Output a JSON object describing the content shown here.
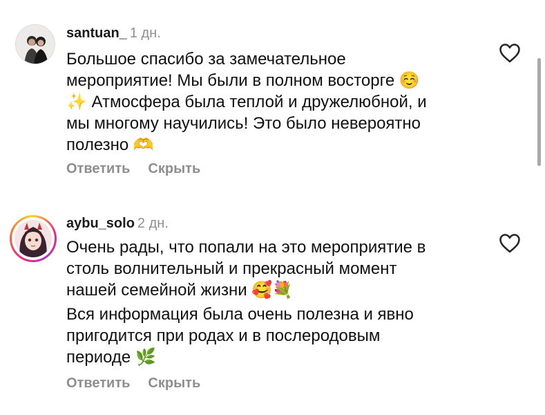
{
  "comments": [
    {
      "username": "santuan_",
      "time": "1 дн.",
      "lines": [
        "Большое спасибо за замечательное",
        "мероприятие! Мы были в полном восторге ☺️",
        "✨ Атмосфера была теплой и дружелюбной, и",
        "мы многому научились! Это было невероятно",
        "полезно 🫶"
      ],
      "reply_label": "Ответить",
      "hide_label": "Скрыть"
    },
    {
      "username": "aybu_solo",
      "time": "2 дн.",
      "lines": [
        "Очень рады, что попали на это мероприятие в",
        "столь волнительный и прекрасный момент",
        "нашей семейной жизни 🥰💐",
        "Вся информация была очень полезна и явно",
        "пригодится при родах и в послеродовым",
        "периоде 🌿"
      ],
      "reply_label": "Ответить",
      "hide_label": "Скрыть"
    }
  ],
  "colors": {
    "username": "#1a1a1a",
    "secondary_text": "#8e8e8e",
    "body_text": "#111111",
    "story_ring": [
      "#f9ce34",
      "#ee2a7b",
      "#b32fc2"
    ]
  },
  "icons": {
    "like": "heart-outline-icon"
  }
}
